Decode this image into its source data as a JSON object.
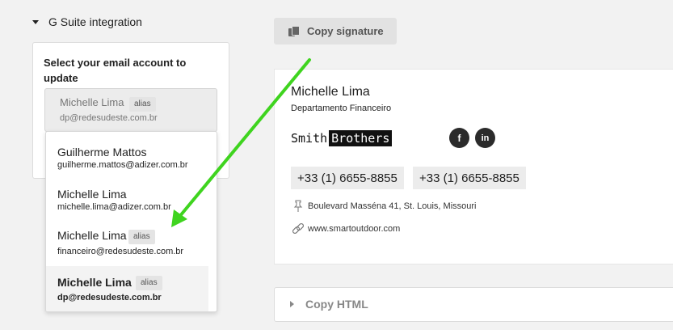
{
  "gsuite": {
    "title": "G Suite integration",
    "panel_heading": "Select your email account to update",
    "current": {
      "name": "Michelle Lima",
      "badge": "alias",
      "email": "dp@redesudeste.com.br"
    }
  },
  "accounts": [
    {
      "name": "Guilherme Mattos",
      "email": "guilherme.mattos@adizer.com.br",
      "badge": ""
    },
    {
      "name": "Michelle Lima",
      "email": "michelle.lima@adizer.com.br",
      "badge": ""
    },
    {
      "name": "Michelle Lima",
      "email": "financeiro@redesudeste.com.br",
      "badge": "alias"
    },
    {
      "name": "Michelle Lima",
      "email": "dp@redesudeste.com.br",
      "badge": "alias",
      "selected": true
    }
  ],
  "toolbar": {
    "copy_signature_label": "Copy signature"
  },
  "signature": {
    "name": "Michelle Lima",
    "department": "Departamento Financeiro",
    "logo_part1": "Smith",
    "logo_part2": "Brothers",
    "social": [
      {
        "icon": "facebook-icon",
        "glyph": "f"
      },
      {
        "icon": "linkedin-icon",
        "glyph": "in"
      }
    ],
    "phones": [
      "+33 (1) 6655-8855",
      "+33 (1) 6655-8855"
    ],
    "address": "Boulevard Masséna 41, St. Louis, Missouri",
    "website": "www.smartoutdoor.com"
  },
  "copy_html_label": "Copy HTML",
  "colors": {
    "arrow": "#3fd41f",
    "selected_row": "#f3f3f3",
    "button_bg": "#e2e2e2"
  }
}
